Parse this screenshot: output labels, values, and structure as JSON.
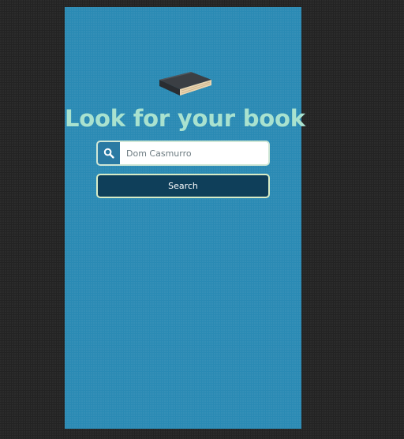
{
  "header": {
    "icon": "book-icon",
    "title": "Look for your book"
  },
  "search": {
    "icon": "search-icon",
    "placeholder": "Dom Casmurro",
    "value": ""
  },
  "actions": {
    "search_label": "Search"
  },
  "colors": {
    "background": "#232323",
    "panel": "#2a8ab4",
    "title": "#a9e2cf",
    "button": "#0f3f5a",
    "border": "#d8ecc6"
  }
}
